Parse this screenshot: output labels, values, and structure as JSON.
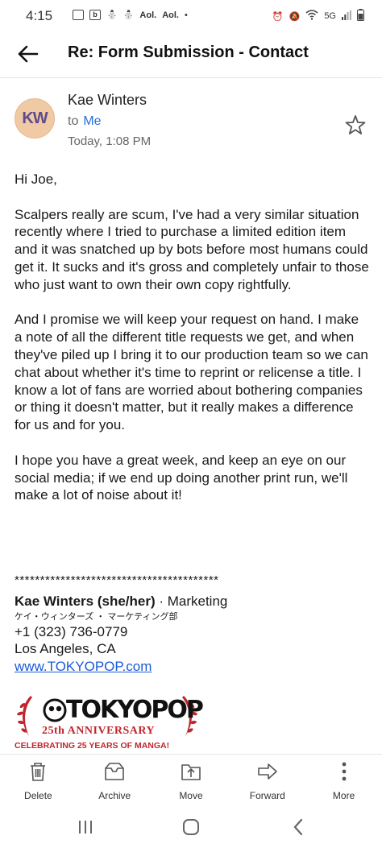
{
  "status_bar": {
    "time": "4:15",
    "notif_aol_1": "Aol.",
    "notif_aol_2": "Aol.",
    "network": "5G"
  },
  "header": {
    "title": "Re: Form Submission - Contact"
  },
  "message": {
    "avatar_initials": "KW",
    "sender": "Kae Winters",
    "to_prefix": "to",
    "to_name": "Me",
    "date": "Today, 1:08 PM",
    "paragraphs": [
      "Hi Joe,",
      "Scalpers really are scum, I've had a very similar situation recently where I tried to purchase a limited edition item and it was snatched up by bots before most humans could get it. It sucks and it's gross and completely unfair to those who just want to own their own copy rightfully.",
      "And I promise we will keep your request on hand. I make a note of all the different title requests we get, and when they've piled up I bring it to our production team so we can chat about whether it's time to reprint or relicense a title. I know a lot of fans are worried about bothering companies or thing it doesn't matter, but it really makes a difference for us and for you.",
      "I hope you have a great week, and keep an eye on our social media; if we end up doing another print run, we'll make a lot of noise about it!"
    ]
  },
  "signature": {
    "stars": "****************************************",
    "name": "Kae Winters (she/her)",
    "role": " · Marketing",
    "japanese": "ケイ・ウィンターズ ・ マーケティング部",
    "phone": "+1 (323) 736-0779",
    "city": "Los Angeles, CA",
    "website": "www.TOKYOPOP.com",
    "logo_word": "TOKYOPOP",
    "logo_anniversary": "25th ANNIVERSARY",
    "logo_tagline": "CELEBRATING 25 YEARS OF MANGA!"
  },
  "toolbar": {
    "delete": "Delete",
    "archive": "Archive",
    "move": "Move",
    "forward": "Forward",
    "more": "More"
  }
}
